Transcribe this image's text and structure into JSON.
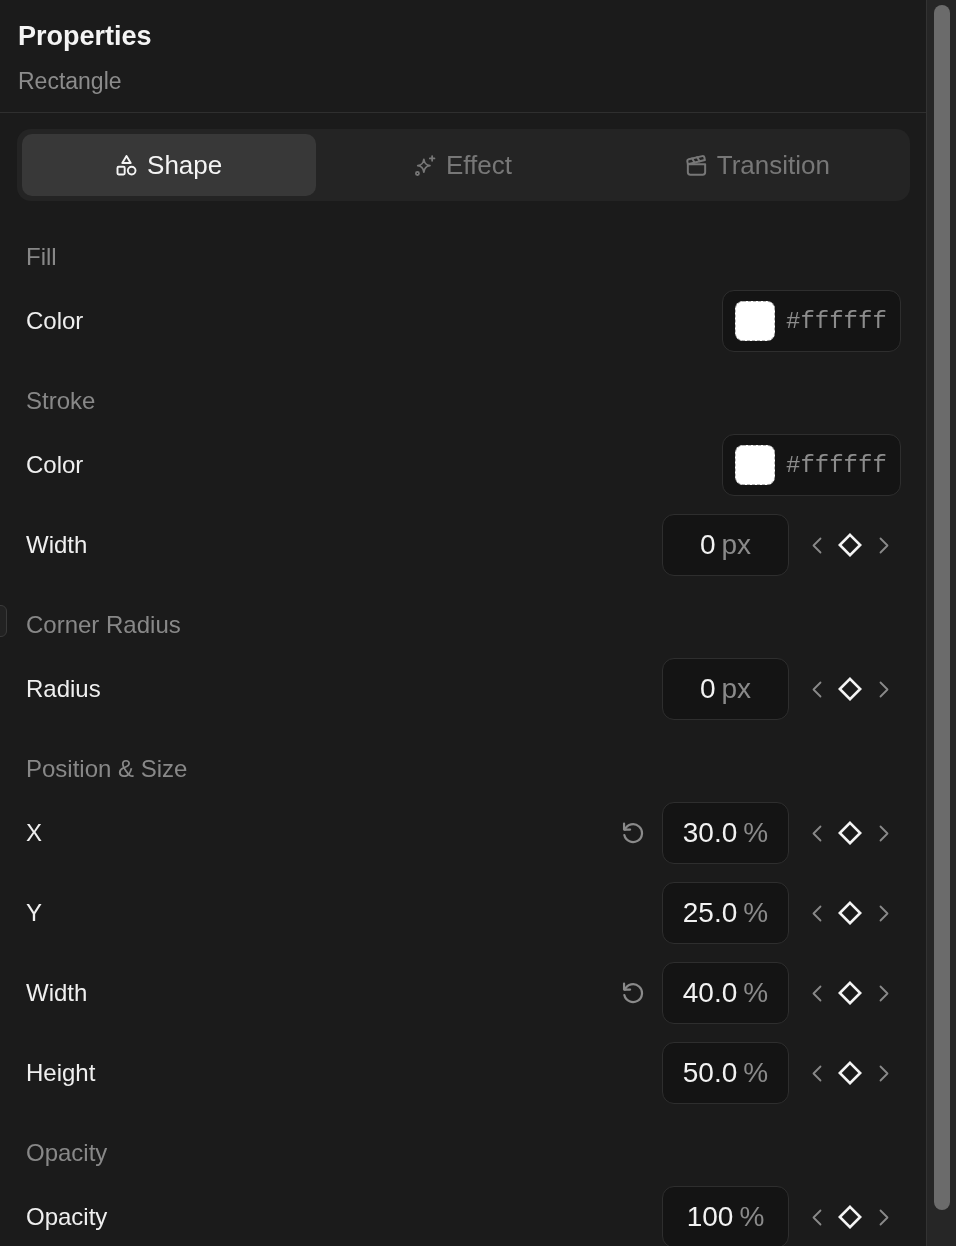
{
  "panel": {
    "title": "Properties",
    "subtitle": "Rectangle"
  },
  "tabs": [
    {
      "label": "Shape",
      "selected": true
    },
    {
      "label": "Effect",
      "selected": false
    },
    {
      "label": "Transition",
      "selected": false
    }
  ],
  "sections": [
    {
      "heading": "Fill",
      "rows": [
        {
          "kind": "color",
          "label": "Color",
          "color": "#ffffff",
          "value": "#ffffff"
        }
      ]
    },
    {
      "heading": "Stroke",
      "rows": [
        {
          "kind": "color",
          "label": "Color",
          "color": "#ffffff",
          "value": "#ffffff"
        },
        {
          "kind": "number",
          "label": "Width",
          "value": "0",
          "unit": "px",
          "resettable": false,
          "keyframe": false
        }
      ]
    },
    {
      "heading": "Corner Radius",
      "rows": [
        {
          "kind": "number",
          "label": "Radius",
          "value": "0",
          "unit": "px",
          "resettable": false,
          "keyframe": false
        }
      ]
    },
    {
      "heading": "Position & Size",
      "rows": [
        {
          "kind": "number",
          "label": "X",
          "value": "30.0",
          "unit": "%",
          "resettable": true,
          "keyframe": false
        },
        {
          "kind": "number",
          "label": "Y",
          "value": "25.0",
          "unit": "%",
          "resettable": false,
          "keyframe": false
        },
        {
          "kind": "number",
          "label": "Width",
          "value": "40.0",
          "unit": "%",
          "resettable": true,
          "keyframe": false
        },
        {
          "kind": "number",
          "label": "Height",
          "value": "50.0",
          "unit": "%",
          "resettable": false,
          "keyframe": false
        }
      ]
    },
    {
      "heading": "Opacity",
      "rows": [
        {
          "kind": "number",
          "label": "Opacity",
          "value": "100",
          "unit": "%",
          "resettable": false,
          "keyframe": false
        }
      ]
    }
  ]
}
